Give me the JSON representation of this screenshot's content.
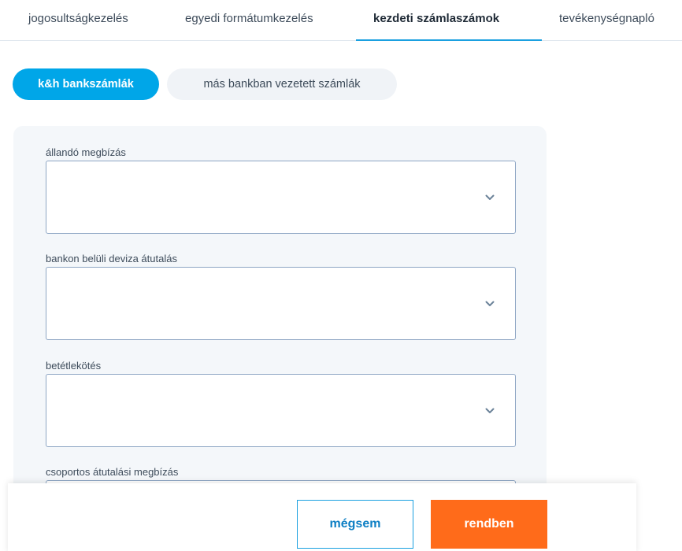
{
  "tabs": [
    {
      "label": "jogosultságkezelés",
      "active": false
    },
    {
      "label": "egyedi formátumkezelés",
      "active": false
    },
    {
      "label": "kezdeti számlaszámok",
      "active": true
    },
    {
      "label": "tevékenységnapló",
      "active": false
    }
  ],
  "subtabs": [
    {
      "label": "k&h bankszámlák",
      "active": true
    },
    {
      "label": "más bankban vezetett számlák",
      "active": false
    }
  ],
  "fields": [
    {
      "label": "állandó megbízás",
      "value": ""
    },
    {
      "label": "bankon belüli deviza átutalás",
      "value": ""
    },
    {
      "label": "betétlekötés",
      "value": ""
    },
    {
      "label": "csoportos átutalási megbízás",
      "value": ""
    }
  ],
  "actions": {
    "cancel_label": "mégsem",
    "ok_label": "rendben"
  },
  "icons": {
    "dropdown": "chevron-down-icon"
  },
  "colors": {
    "accent": "#00a6e8",
    "primary_button": "#ff6b1a",
    "cancel_border": "#1aa0e0",
    "panel_bg": "#f4f7fa"
  }
}
